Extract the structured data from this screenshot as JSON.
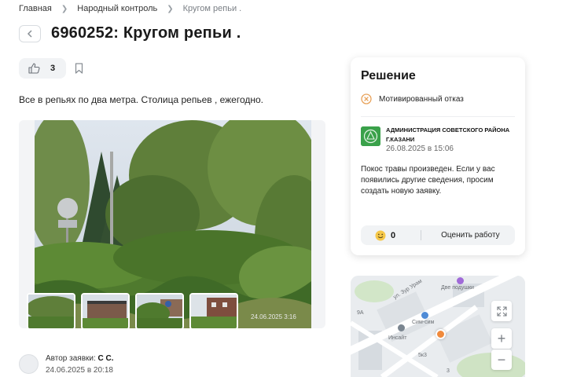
{
  "breadcrumbs": [
    {
      "label": "Главная"
    },
    {
      "label": "Народный контроль"
    },
    {
      "label": "Кругом репьи ."
    }
  ],
  "back_icon": "chevron-left-icon",
  "title": "6960252: Кругом репьи .",
  "likes": {
    "count": "3",
    "icon": "thumbs-up-icon"
  },
  "bookmark_icon": "bookmark-icon",
  "description": "Все в репьях по два метра. Столица репьев , ежегодно.",
  "photo": {
    "timestamp": "24.06.2025 3:16"
  },
  "thumbnails_count": 4,
  "author": {
    "label": "Автор заявки:",
    "name": "С С.",
    "date": "24.06.2025 в 20:18"
  },
  "decision": {
    "title": "Решение",
    "status": "Мотивированный отказ",
    "status_color": "#e8a25a",
    "organization": "АДМИНИСТРАЦИЯ СОВЕТСКОГО РАЙОНА Г.КАЗАНИ",
    "date": "26.08.2025 в 15:06",
    "answer": "Покос травы произведен. Если у вас появились другие сведения, просим создать новую заявку.",
    "rating_count": "0",
    "rate_label": "Оценить работу"
  },
  "map": {
    "labels": {
      "street": "ул. Зур Урам",
      "shop1": "Две подушки",
      "shop2": "Сим-сим",
      "shop3": "Инсайт",
      "num_9a": "9А",
      "num_5k3": "5к3",
      "num_3": "3"
    },
    "marker_color": "#f08a3c",
    "controls": {
      "fullscreen": "fullscreen-icon",
      "zoom_in": "+",
      "zoom_out": "−"
    }
  },
  "colors": {
    "accent_green": "#3aa14a",
    "panel_bg": "#f1f3f5"
  }
}
